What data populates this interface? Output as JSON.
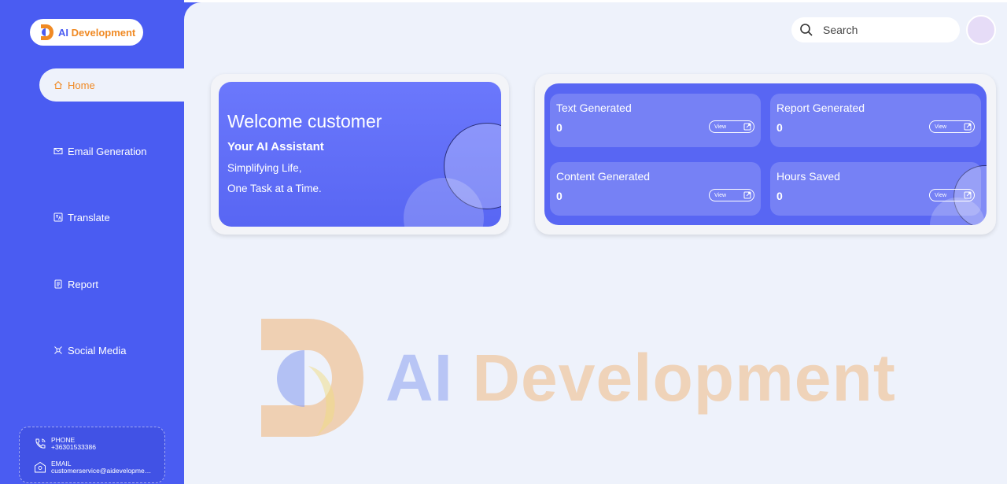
{
  "brand": {
    "ai": "AI",
    "dev": "Development"
  },
  "nav": [
    {
      "label": "Home",
      "icon": "home-icon",
      "active": true
    },
    {
      "label": "Email Generation",
      "icon": "mail-icon"
    },
    {
      "label": "Translate",
      "icon": "translate-icon"
    },
    {
      "label": "Report",
      "icon": "report-icon"
    },
    {
      "label": "Social Media",
      "icon": "social-icon"
    }
  ],
  "contact": {
    "phone_label": "PHONE",
    "phone_value": "+36301533386",
    "email_label": "EMAIL",
    "email_value": "customerservice@aidevelopment.hu"
  },
  "search": {
    "placeholder": "Search"
  },
  "welcome": {
    "title": "Welcome customer",
    "subtitle": "Your AI Assistant",
    "line1": "Simplifying Life,",
    "line2": "One Task at a Time."
  },
  "stats": [
    {
      "label": "Text Generated",
      "value": "0",
      "button": "View"
    },
    {
      "label": "Report Generated",
      "value": "0",
      "button": "View"
    },
    {
      "label": "Content Generated",
      "value": "0",
      "button": "View"
    },
    {
      "label": "Hours Saved",
      "value": "0",
      "button": "View"
    }
  ],
  "watermark": {
    "ai": "AI",
    "dev": "Development"
  },
  "colors": {
    "primary": "#4a5cf2",
    "accent": "#f08a24",
    "background": "#eef2fb"
  }
}
